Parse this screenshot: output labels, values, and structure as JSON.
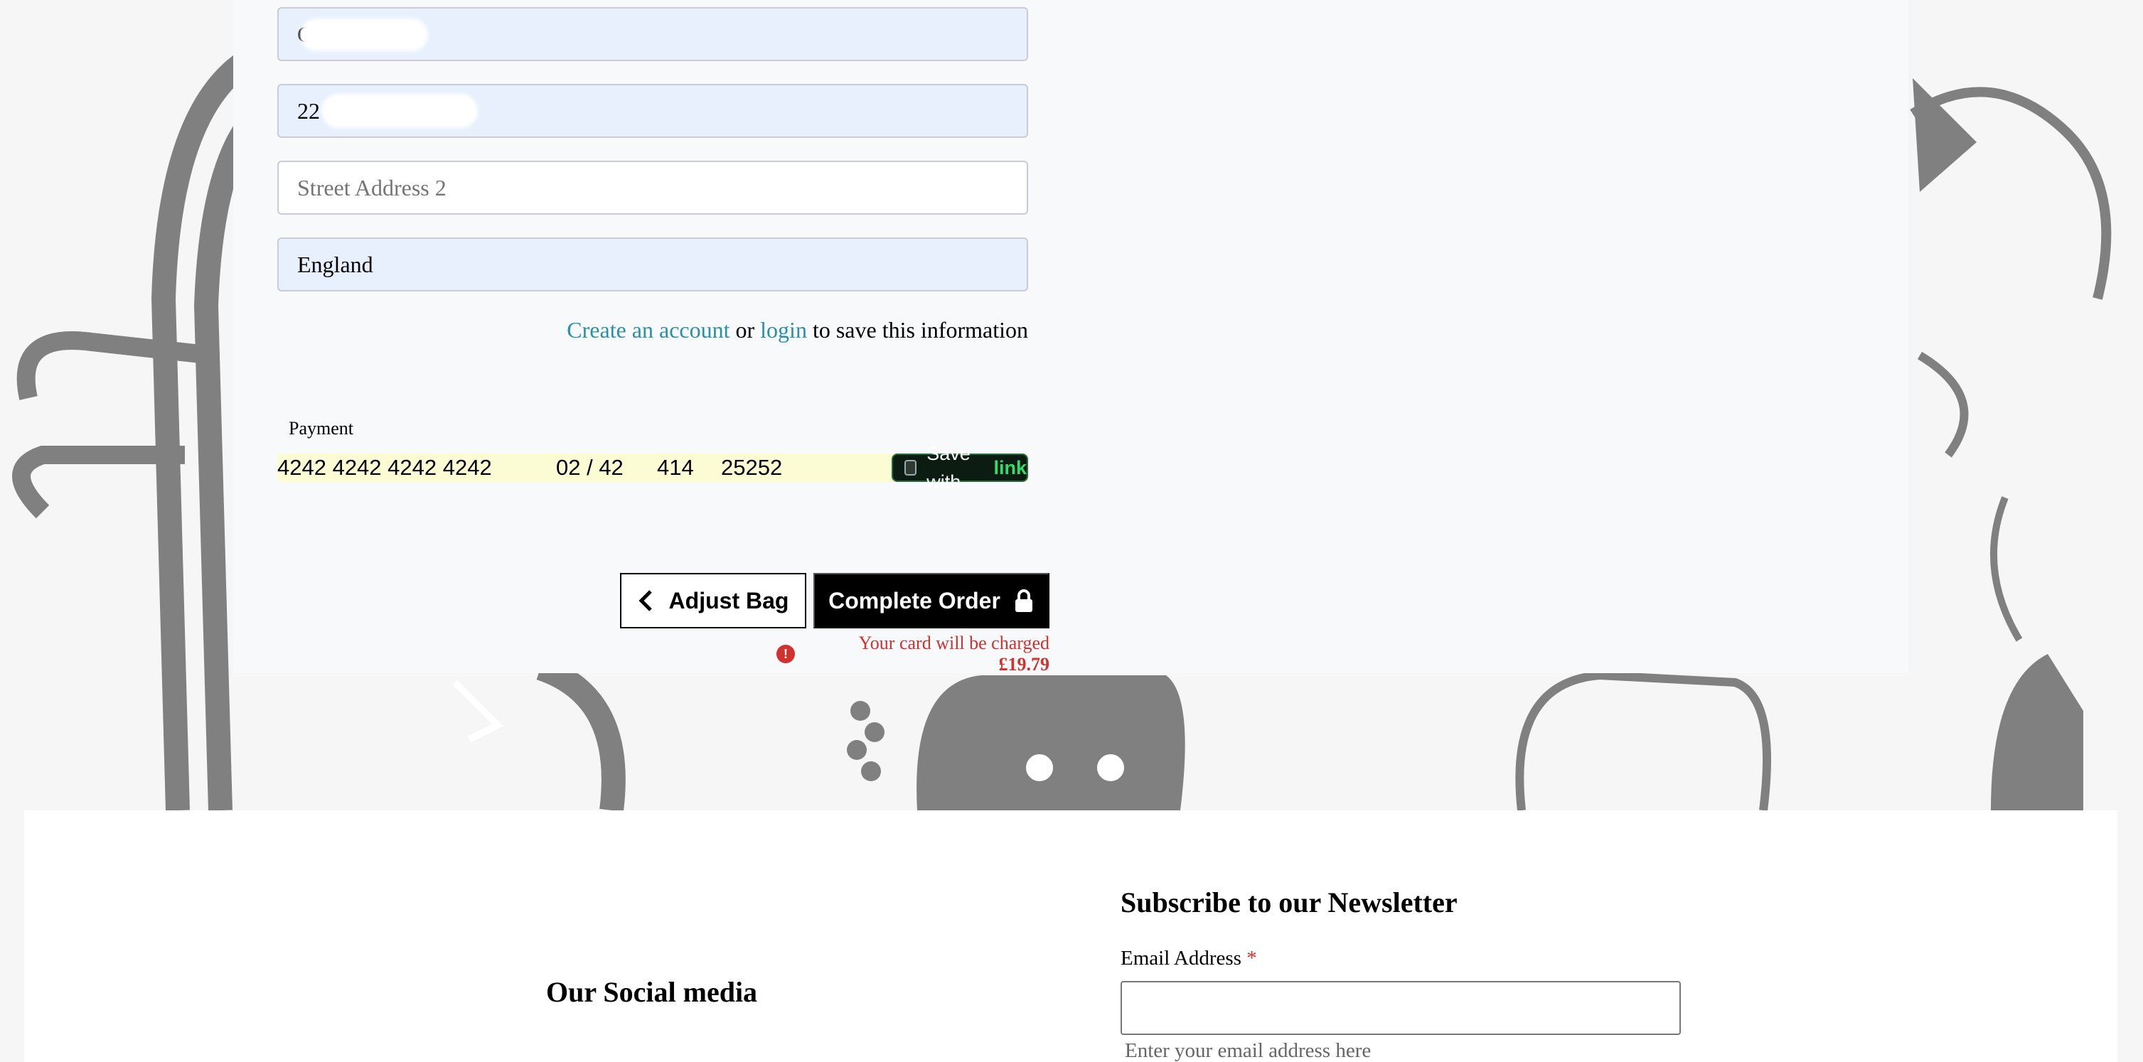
{
  "checkout": {
    "fields": {
      "city_value": "C",
      "street1_value": "22 cro",
      "street2_placeholder": "Street Address 2",
      "country_value": "England"
    },
    "account_prompt": {
      "create_link": "Create an account",
      "or_text": "or",
      "login_link": "login",
      "suffix": "to save this information"
    },
    "payment": {
      "label": "Payment",
      "card_number": "4242 4242 4242 4242",
      "expiry": "02 / 42",
      "cvc": "414",
      "postcode": "25252",
      "save_with": "Save with",
      "link_brand": "link"
    },
    "buttons": {
      "adjust_bag": "Adjust Bag",
      "complete_order": "Complete Order"
    },
    "charge_notice": {
      "text": "Your card will be charged",
      "amount": "£19.79"
    }
  },
  "footer": {
    "social_heading": "Our Social media",
    "newsletter_heading": "Subscribe to our Newsletter",
    "email_label": "Email Address",
    "required_mark": "*",
    "email_hint": "Enter your email address here"
  },
  "colors": {
    "link": "#2a8fa8",
    "error": "#d1312f",
    "autofill": "#e8f0fe",
    "card_autofill": "#fbfcd4",
    "link_brand": "#33dd6b"
  }
}
